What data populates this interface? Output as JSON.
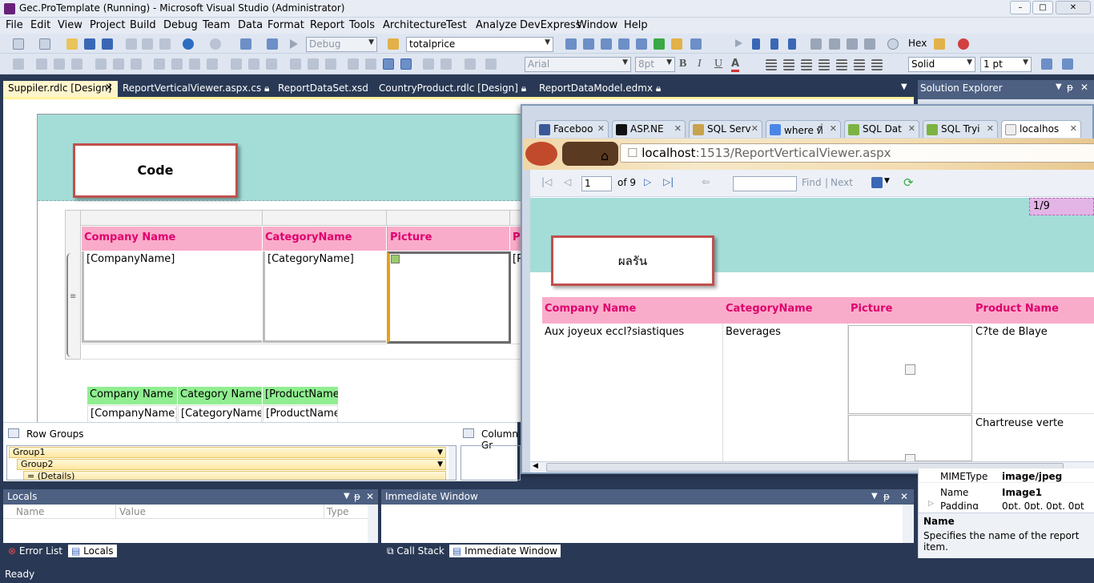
{
  "window": {
    "title": "Gec.ProTemplate (Running) - Microsoft Visual Studio (Administrator)",
    "min": "–",
    "max": "□",
    "close": "✕"
  },
  "menu": [
    "File",
    "Edit",
    "View",
    "Project",
    "Build",
    "Debug",
    "Team",
    "Data",
    "Format",
    "Report",
    "Tools",
    "Architecture",
    "Test",
    "Analyze",
    "DevExpress",
    "Window",
    "Help"
  ],
  "toolbar": {
    "config": "Debug",
    "find": "totalprice",
    "hex": "Hex",
    "font": "Arial",
    "size": "8pt",
    "bold": "B",
    "italic": "I",
    "underline": "U",
    "font_color": "A",
    "border_style": "Solid",
    "border_width": "1 pt"
  },
  "doc_tabs": [
    {
      "label": "Suppiler.rdlc [Design]",
      "active": true
    },
    {
      "label": "ReportVerticalViewer.aspx.cs",
      "active": false
    },
    {
      "label": "ReportDataSet.xsd",
      "active": false
    },
    {
      "label": "CountryProduct.rdlc [Design]",
      "active": false
    },
    {
      "label": "ReportDataModel.edmx",
      "active": false
    }
  ],
  "design": {
    "callout": "Code",
    "headers": [
      "Company Name",
      "CategoryName",
      "Picture",
      "Pr"
    ],
    "fields": [
      "[CompanyName]",
      "[CategoryName]",
      "[P"
    ],
    "green_headers": [
      "Company Name",
      "Category Name",
      "[ProductName]"
    ],
    "green_fields": [
      "[CompanyName]",
      "[CategoryName]",
      "[ProductName]"
    ]
  },
  "groups": {
    "row_title": "Row Groups",
    "col_title": "Column Gr",
    "items": [
      "Group1",
      "Group2",
      "= (Details)"
    ]
  },
  "browser": {
    "tabs": [
      "Faceboo",
      "ASP.NE",
      "SQL Serv",
      "where ที่",
      "SQL Dat",
      "SQL Tryi",
      "localhos"
    ],
    "url_host": "localhost",
    "url_rest": ":1513/ReportVerticalViewer.aspx",
    "page_num": "1",
    "of_pages": "of 9",
    "find_label": "Find",
    "next_label": "Next",
    "page_badge": "1/9",
    "callout": "ผลรัน",
    "headers": [
      "Company Name",
      "CategoryName",
      "Picture",
      "Product Name"
    ],
    "rows": [
      {
        "company": "Aux joyeux eccl?siastiques",
        "category": "Beverages",
        "product": "C?te de Blaye"
      },
      {
        "company": "",
        "category": "",
        "product": "Chartreuse verte"
      }
    ]
  },
  "solution_explorer": {
    "title": "Solution Explorer"
  },
  "properties": {
    "rows": [
      {
        "name": "MIMEType",
        "value": "image/jpeg"
      },
      {
        "name": "Name",
        "value": "Image1"
      },
      {
        "name": "Padding",
        "value": "0pt, 0pt, 0pt, 0pt"
      }
    ],
    "desc_title": "Name",
    "desc_text": "Specifies the name of the report item."
  },
  "locals": {
    "title": "Locals",
    "cols": [
      "Name",
      "Value",
      "Type"
    ],
    "tab_error": "Error List",
    "tab_locals": "Locals"
  },
  "immediate": {
    "title": "Immediate Window",
    "tab_callstack": "Call Stack",
    "tab_immediate": "Immediate Window"
  },
  "status": "Ready"
}
